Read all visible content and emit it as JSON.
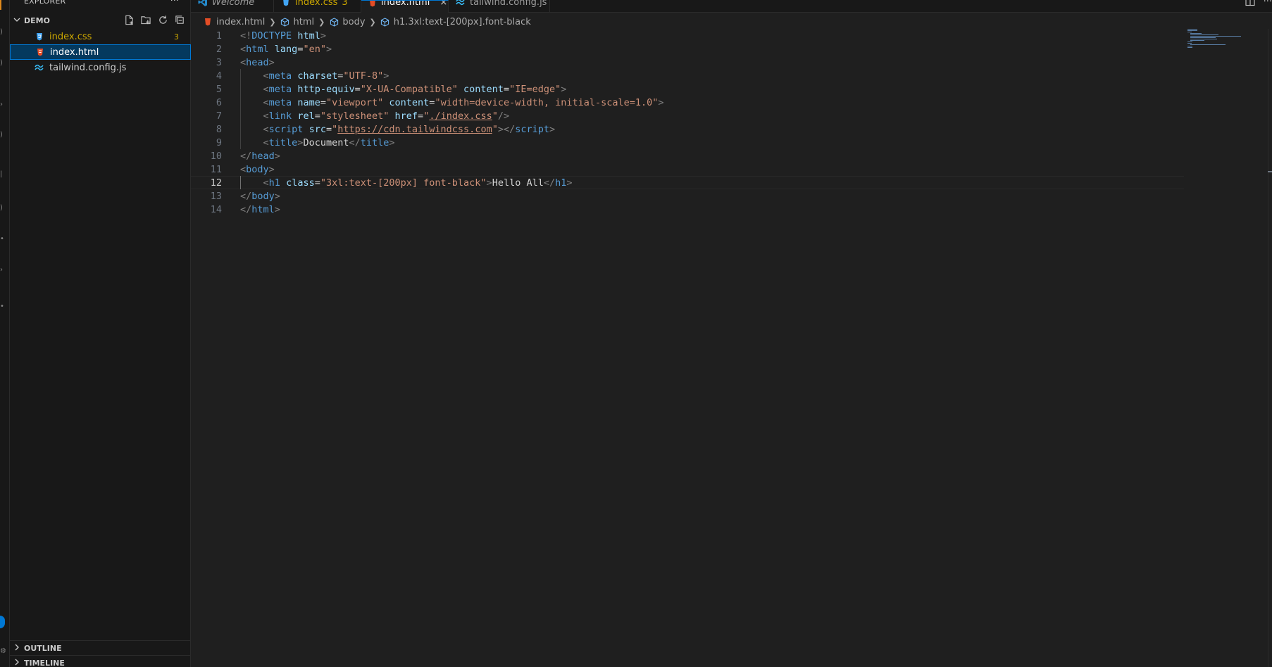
{
  "explorer": {
    "title": "EXPLORER",
    "more": "···",
    "folder": "DEMO",
    "files": [
      {
        "name": "index.css",
        "badge": "3",
        "icon": "css-file-icon",
        "warn": true
      },
      {
        "name": "index.html",
        "badge": "",
        "icon": "html-file-icon",
        "selected": true
      },
      {
        "name": "tailwind.config.js",
        "badge": "",
        "icon": "tailwind-file-icon"
      }
    ],
    "outline": "OUTLINE",
    "timeline": "TIMELINE"
  },
  "tabs": [
    {
      "label": "Welcome",
      "icon": "vscode-icon"
    },
    {
      "label": "index.css",
      "badge": "3",
      "icon": "css-file-icon"
    },
    {
      "label": "index.html",
      "icon": "html-file-icon",
      "active": true,
      "close": "×"
    },
    {
      "label": "tailwind.config.js",
      "icon": "tailwind-file-icon"
    }
  ],
  "breadcrumb": [
    "index.html",
    "html",
    "body",
    "h1.3xl:text-[200px].font-black"
  ],
  "editor": {
    "current_line": 12,
    "lines": [
      {
        "n": "1",
        "code": [
          [
            "t-punct",
            "<!"
          ],
          [
            "t-doctype",
            "DOCTYPE"
          ],
          [
            "t-text",
            " "
          ],
          [
            "t-attr",
            "html"
          ],
          [
            "t-punct",
            ">"
          ]
        ]
      },
      {
        "n": "2",
        "code": [
          [
            "t-punct",
            "<"
          ],
          [
            "t-tag",
            "html"
          ],
          [
            "t-text",
            " "
          ],
          [
            "t-attr",
            "lang"
          ],
          [
            "t-text",
            "="
          ],
          [
            "t-str",
            "\"en\""
          ],
          [
            "t-punct",
            ">"
          ]
        ]
      },
      {
        "n": "3",
        "code": [
          [
            "t-punct",
            "<"
          ],
          [
            "t-tag",
            "head"
          ],
          [
            "t-punct",
            ">"
          ]
        ]
      },
      {
        "n": "4",
        "code": [
          [
            "t-text",
            "    "
          ],
          [
            "t-punct",
            "<"
          ],
          [
            "t-tag",
            "meta"
          ],
          [
            "t-text",
            " "
          ],
          [
            "t-attr",
            "charset"
          ],
          [
            "t-text",
            "="
          ],
          [
            "t-str",
            "\"UTF-8\""
          ],
          [
            "t-punct",
            ">"
          ]
        ]
      },
      {
        "n": "5",
        "code": [
          [
            "t-text",
            "    "
          ],
          [
            "t-punct",
            "<"
          ],
          [
            "t-tag",
            "meta"
          ],
          [
            "t-text",
            " "
          ],
          [
            "t-attr",
            "http-equiv"
          ],
          [
            "t-text",
            "="
          ],
          [
            "t-str",
            "\"X-UA-Compatible\""
          ],
          [
            "t-text",
            " "
          ],
          [
            "t-attr",
            "content"
          ],
          [
            "t-text",
            "="
          ],
          [
            "t-str",
            "\"IE=edge\""
          ],
          [
            "t-punct",
            ">"
          ]
        ]
      },
      {
        "n": "6",
        "code": [
          [
            "t-text",
            "    "
          ],
          [
            "t-punct",
            "<"
          ],
          [
            "t-tag",
            "meta"
          ],
          [
            "t-text",
            " "
          ],
          [
            "t-attr",
            "name"
          ],
          [
            "t-text",
            "="
          ],
          [
            "t-str",
            "\"viewport\""
          ],
          [
            "t-text",
            " "
          ],
          [
            "t-attr",
            "content"
          ],
          [
            "t-text",
            "="
          ],
          [
            "t-str",
            "\"width=device-width, initial-scale=1.0\""
          ],
          [
            "t-punct",
            ">"
          ]
        ]
      },
      {
        "n": "7",
        "code": [
          [
            "t-text",
            "    "
          ],
          [
            "t-punct",
            "<"
          ],
          [
            "t-tag",
            "link"
          ],
          [
            "t-text",
            " "
          ],
          [
            "t-attr",
            "rel"
          ],
          [
            "t-text",
            "="
          ],
          [
            "t-str",
            "\"stylesheet\""
          ],
          [
            "t-text",
            " "
          ],
          [
            "t-attr",
            "href"
          ],
          [
            "t-text",
            "="
          ],
          [
            "t-str",
            "\""
          ],
          [
            "t-str t-link",
            "./index.css"
          ],
          [
            "t-str",
            "\""
          ],
          [
            "t-punct",
            "/>"
          ]
        ]
      },
      {
        "n": "8",
        "code": [
          [
            "t-text",
            "    "
          ],
          [
            "t-punct",
            "<"
          ],
          [
            "t-tag",
            "script"
          ],
          [
            "t-text",
            " "
          ],
          [
            "t-attr",
            "src"
          ],
          [
            "t-text",
            "="
          ],
          [
            "t-str",
            "\""
          ],
          [
            "t-str t-link",
            "https://cdn.tailwindcss.com"
          ],
          [
            "t-str",
            "\""
          ],
          [
            "t-punct",
            "></"
          ],
          [
            "t-tag",
            "script"
          ],
          [
            "t-punct",
            ">"
          ]
        ]
      },
      {
        "n": "9",
        "code": [
          [
            "t-text",
            "    "
          ],
          [
            "t-punct",
            "<"
          ],
          [
            "t-tag",
            "title"
          ],
          [
            "t-punct",
            ">"
          ],
          [
            "t-text",
            "Document"
          ],
          [
            "t-punct",
            "</"
          ],
          [
            "t-tag",
            "title"
          ],
          [
            "t-punct",
            ">"
          ]
        ]
      },
      {
        "n": "10",
        "code": [
          [
            "t-punct",
            "</"
          ],
          [
            "t-tag",
            "head"
          ],
          [
            "t-punct",
            ">"
          ]
        ]
      },
      {
        "n": "11",
        "code": [
          [
            "t-punct",
            "<"
          ],
          [
            "t-tag",
            "body"
          ],
          [
            "t-punct",
            ">"
          ]
        ]
      },
      {
        "n": "12",
        "code": [
          [
            "t-text",
            "    "
          ],
          [
            "t-punct",
            "<"
          ],
          [
            "t-tag",
            "h1"
          ],
          [
            "t-text",
            " "
          ],
          [
            "t-attr",
            "class"
          ],
          [
            "t-text",
            "="
          ],
          [
            "t-str",
            "\"3xl:text-[200px] font-black\""
          ],
          [
            "t-punct",
            ">"
          ],
          [
            "t-text",
            "Hello All"
          ],
          [
            "t-punct",
            "</"
          ],
          [
            "t-tag",
            "h1"
          ],
          [
            "t-punct",
            ">"
          ]
        ]
      },
      {
        "n": "13",
        "code": [
          [
            "t-punct",
            "</"
          ],
          [
            "t-tag",
            "body"
          ],
          [
            "t-punct",
            ">"
          ]
        ]
      },
      {
        "n": "14",
        "code": [
          [
            "t-punct",
            "</"
          ],
          [
            "t-tag",
            "html"
          ],
          [
            "t-punct",
            ">"
          ]
        ]
      }
    ]
  },
  "colors": {
    "accent": "#0078d4",
    "warning": "#cca700",
    "html_icon": "#e44d26",
    "css_icon": "#42a5f5",
    "tailwind_icon": "#38bdf8"
  }
}
